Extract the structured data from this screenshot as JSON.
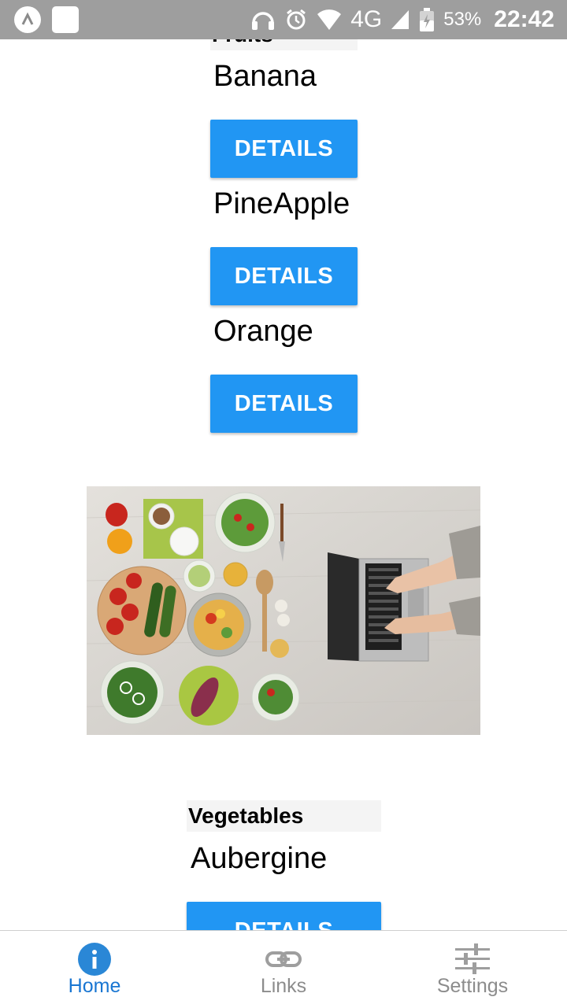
{
  "status_bar": {
    "network": "4G",
    "battery": "53%",
    "time": "22:42"
  },
  "sections": [
    {
      "title": "Fruits",
      "items": [
        {
          "label": "Banana",
          "button": "DETAILS"
        },
        {
          "label": "PineApple",
          "button": "DETAILS"
        },
        {
          "label": "Orange",
          "button": "DETAILS"
        }
      ]
    },
    {
      "title": "Vegetables",
      "items": [
        {
          "label": "Aubergine",
          "button": "DETAILS"
        }
      ]
    }
  ],
  "tabs": [
    {
      "label": "Home",
      "icon": "info-icon",
      "active": true
    },
    {
      "label": "Links",
      "icon": "link-icon",
      "active": false
    },
    {
      "label": "Settings",
      "icon": "sliders-icon",
      "active": false
    }
  ],
  "colors": {
    "accent": "#2196f3",
    "tab_active": "#1976d2",
    "tab_inactive": "#8c8c8c",
    "status_bar": "#9e9e9e",
    "header_bg": "#f4f4f4"
  }
}
